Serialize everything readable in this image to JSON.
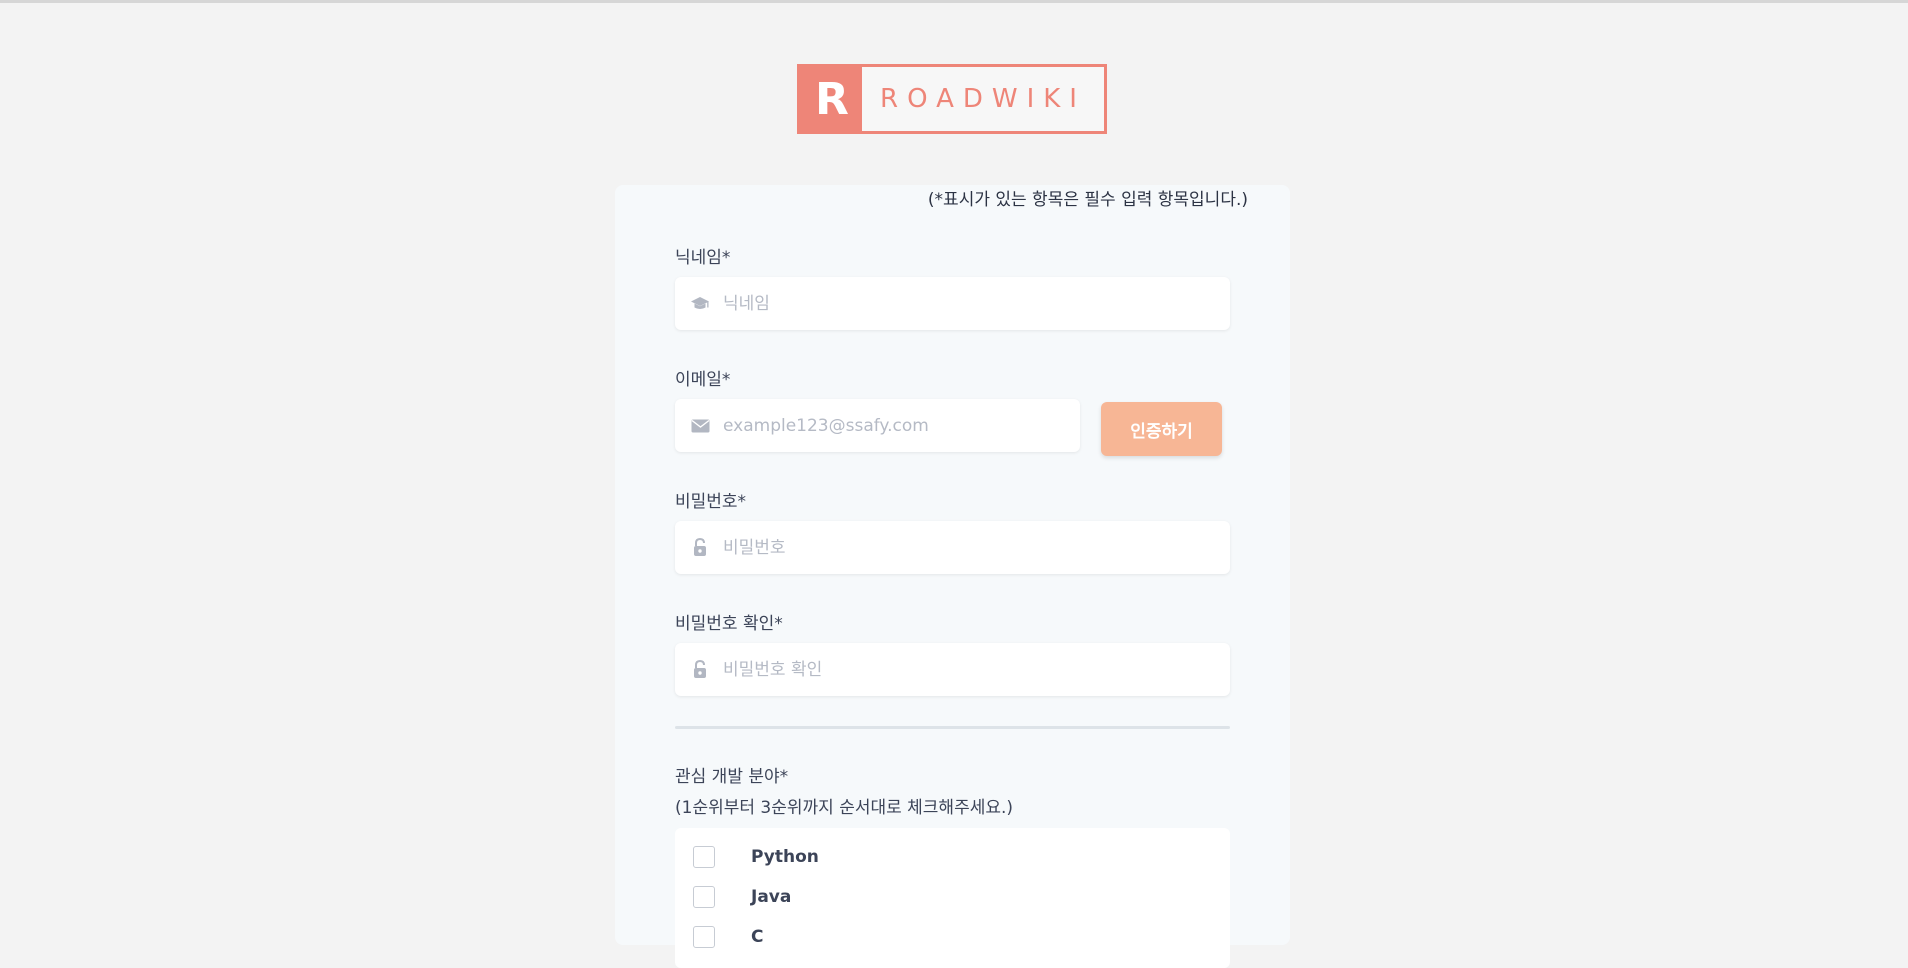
{
  "logo": {
    "mark": "R",
    "text": "ROADWIKI"
  },
  "form": {
    "required_note": "(*표시가 있는 항목은 필수 입력 항목입니다.)",
    "nickname": {
      "label": "닉네임*",
      "placeholder": "닉네임",
      "icon": "graduation-cap-icon"
    },
    "email": {
      "label": "이메일*",
      "placeholder": "example123@ssafy.com",
      "icon": "envelope-icon",
      "verify_button": "인증하기"
    },
    "password": {
      "label": "비밀번호*",
      "placeholder": "비밀번호",
      "icon": "lock-icon"
    },
    "password_confirm": {
      "label": "비밀번호 확인*",
      "placeholder": "비밀번호 확인",
      "icon": "lock-icon"
    },
    "interests": {
      "label": "관심 개발 분야*",
      "hint": "(1순위부터 3순위까지 순서대로 체크해주세요.)",
      "options": [
        "Python",
        "Java",
        "C"
      ]
    }
  },
  "colors": {
    "brand": "#ee8578",
    "verify_button": "#f7b695",
    "background": "#f3f3f3",
    "card": "#f6f9fb"
  }
}
